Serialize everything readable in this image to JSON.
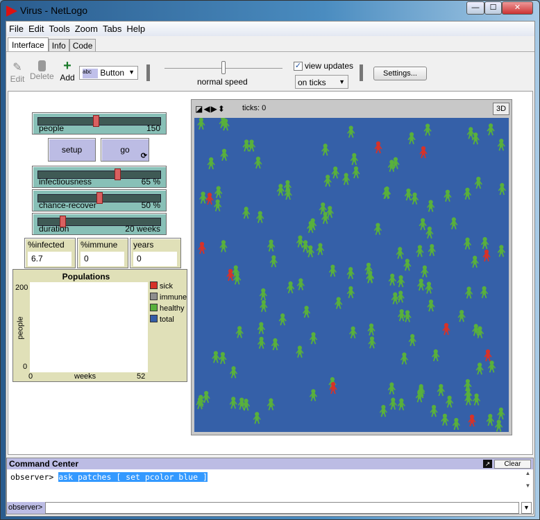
{
  "window": {
    "title": "Virus - NetLogo",
    "minimize": "—",
    "maximize": "☐",
    "close": "✕"
  },
  "menu": [
    "File",
    "Edit",
    "Tools",
    "Zoom",
    "Tabs",
    "Help"
  ],
  "tabs": [
    "Interface",
    "Info",
    "Code"
  ],
  "toolbar": {
    "edit": "Edit",
    "delete": "Delete",
    "add": "Add",
    "widget_type": "Button",
    "speed_label": "normal speed",
    "speed": 0.5,
    "view_updates_label": "view updates",
    "view_updates_checked": true,
    "update_mode": "on ticks",
    "settings": "Settings..."
  },
  "widgets": {
    "people": {
      "label": "people",
      "value": "150",
      "fraction": 0.47
    },
    "setup": "setup",
    "go": "go",
    "infectiousness": {
      "label": "infectiousness",
      "value": "65 %",
      "fraction": 0.65
    },
    "chance_recover": {
      "label": "chance-recover",
      "value": "50 %",
      "fraction": 0.5
    },
    "duration": {
      "label": "duration",
      "value": "20 weeks",
      "fraction": 0.19
    },
    "monitors": [
      {
        "label": "%infected",
        "value": "6.7"
      },
      {
        "label": "%immune",
        "value": "0"
      },
      {
        "label": "years",
        "value": "0"
      }
    ]
  },
  "plot": {
    "title": "Populations",
    "ylabel": "people",
    "xlabel": "weeks",
    "xmin": "0",
    "xmax": "52",
    "ymin": "0",
    "ymax": "200",
    "legend": [
      {
        "name": "sick",
        "color": "#d73229"
      },
      {
        "name": "immune",
        "color": "#8d8d8d"
      },
      {
        "name": "healthy",
        "color": "#59b03c"
      },
      {
        "name": "total",
        "color": "#345da7"
      }
    ]
  },
  "view": {
    "ticks": "ticks: 0",
    "three_d": "3D",
    "patch_color": "#3560a8",
    "sick_color": "#d73229",
    "healthy_color": "#59b03c"
  },
  "command_center": {
    "title": "Command Center",
    "clear": "Clear",
    "prompt": "observer>",
    "history_cmd": "ask patches [ set pcolor blue ]",
    "input_prompt": "observer>"
  }
}
